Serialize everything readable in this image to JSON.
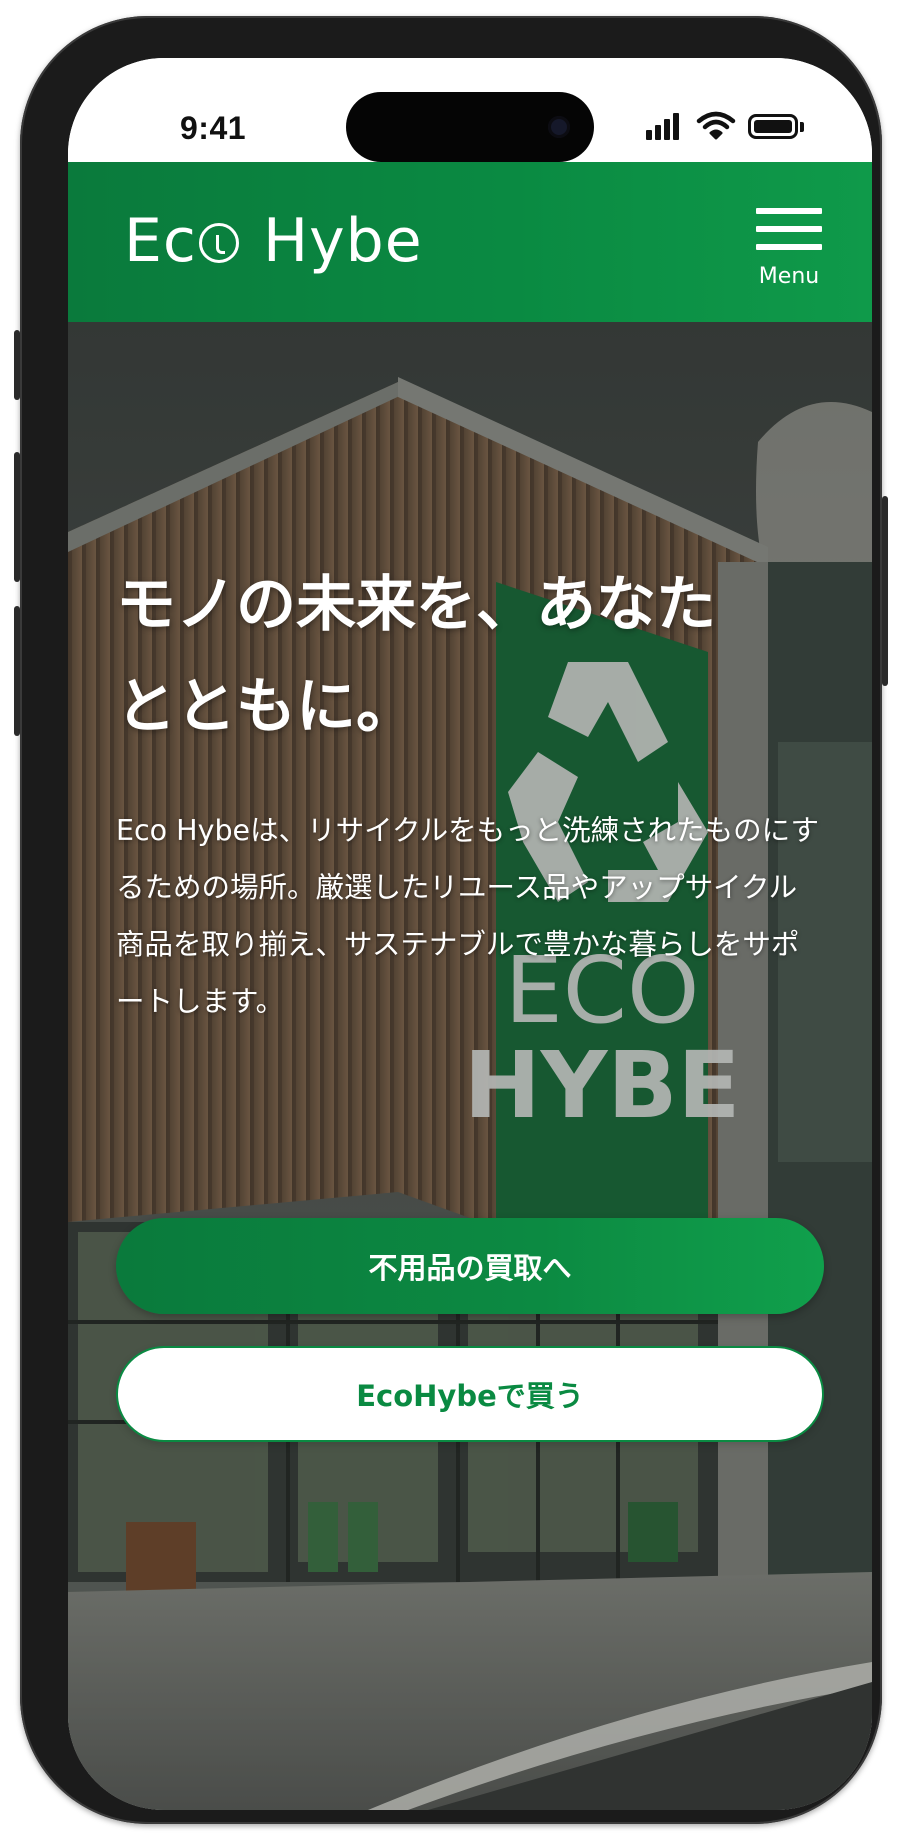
{
  "status_bar": {
    "time": "9:41",
    "icons": [
      "signal-icon",
      "wifi-icon",
      "battery-icon"
    ]
  },
  "header": {
    "logo_left": "Ec",
    "logo_right": " Hybe",
    "menu_label": "Menu",
    "background_color": "#0a8a42"
  },
  "hero": {
    "title_line1": "モノの未来を、あなた",
    "title_line2": "とともに。",
    "description": "Eco Hybeは、リサイクルをもっと洗練されたものにするための場所。厳選したリユース品やアップサイクル商品を取り揃え、サステナブルで豊かな暮らしをサポートします。",
    "sign_line1": "ECO",
    "sign_line2": "HYBE"
  },
  "buttons": {
    "sell_label": "不用品の買取へ",
    "buy_label": "EcoHybeで買う"
  },
  "colors": {
    "brand_green": "#0a8a42",
    "text_on_dark": "#ffffff"
  }
}
